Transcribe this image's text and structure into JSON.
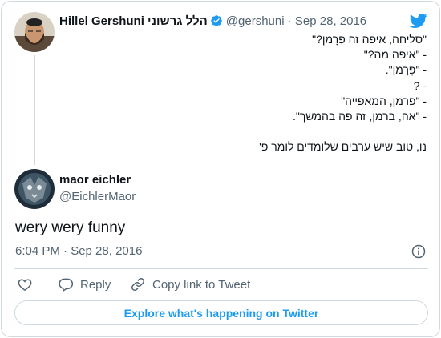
{
  "colors": {
    "accent": "#1d9bf0",
    "text": "#0f1419",
    "muted": "#536471",
    "border": "#cfd9de"
  },
  "quoted_tweet": {
    "name": "Hillel Gershuni הלל גרשוני",
    "handle": "@gershuni",
    "separator": "·",
    "date": "Sep 28, 2016",
    "lines": [
      "\"סליחה, איפה זה פְּרָמן?\"",
      "- \"איפה מה?\"",
      "- \"פְּרָמן\".",
      "- ?",
      "- \"פרמן, המאפייה\"",
      "- \"אה, ברמן, זה פה בהמשך\".",
      "",
      "נו, טוב שיש ערבים שלומדים לומר פ'"
    ]
  },
  "reply_tweet": {
    "name": "maor eichler",
    "handle": "@EichlerMaor",
    "text": "wery wery funny",
    "timestamp": "6:04 PM · Sep 28, 2016"
  },
  "actions": {
    "reply_label": "Reply",
    "copy_label": "Copy link to Tweet"
  },
  "explore_label": "Explore what's happening on Twitter",
  "icons": [
    "twitter-bird-icon",
    "verified-badge-icon",
    "info-icon",
    "heart-icon",
    "reply-bubble-icon",
    "link-icon"
  ]
}
